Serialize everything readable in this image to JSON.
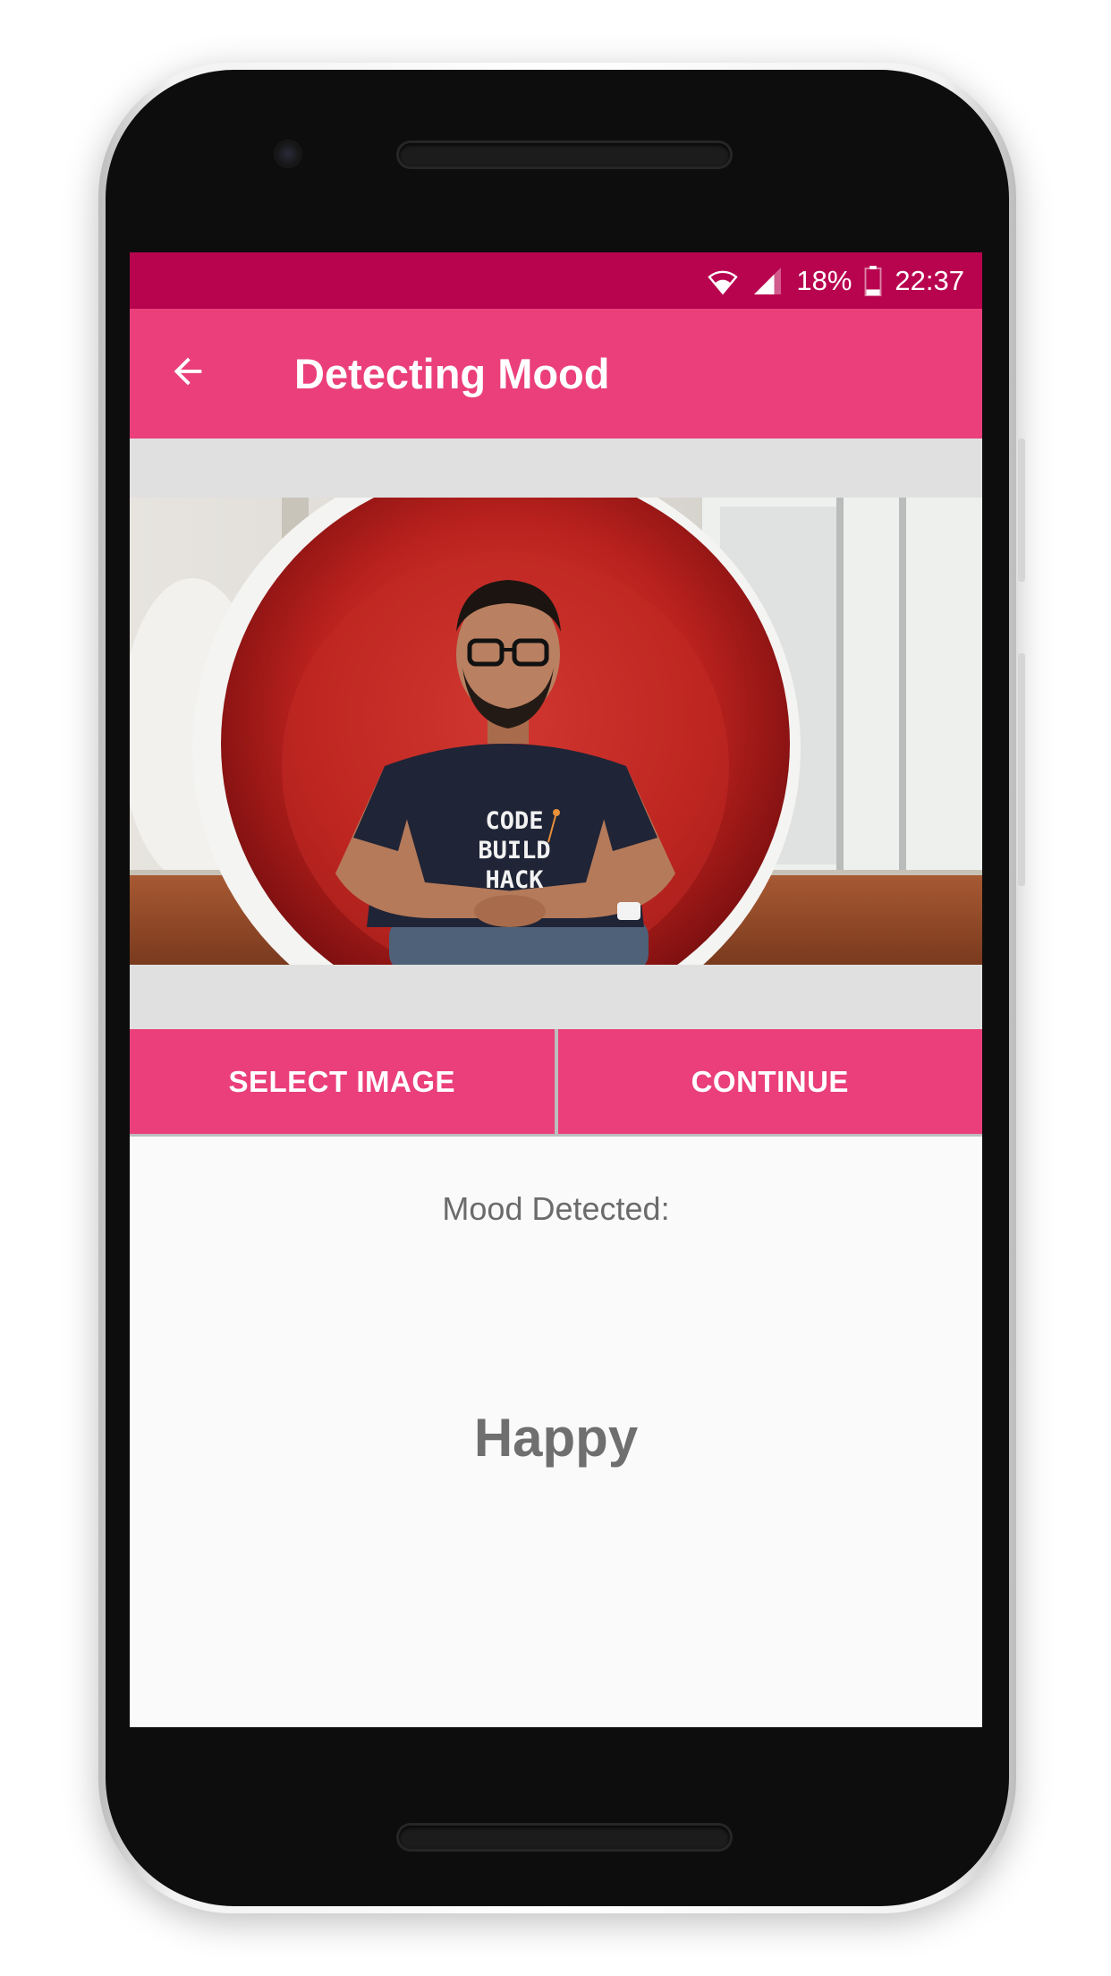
{
  "status_bar": {
    "battery": "18%",
    "time": "22:37",
    "icons": [
      "wifi-icon",
      "signal-icon",
      "battery-icon"
    ]
  },
  "toolbar": {
    "title": "Detecting Mood",
    "back_icon": "arrow-left-icon"
  },
  "photo": {
    "shirt_text_line1": "CODE",
    "shirt_text_line2": "BUILD",
    "shirt_text_line3": "HACK"
  },
  "actions": {
    "select_image": "SELECT IMAGE",
    "continue": "CONTINUE"
  },
  "result": {
    "label": "Mood Detected:",
    "value": "Happy"
  },
  "colors": {
    "status_bar": "#b8044f",
    "accent": "#ea3f7a",
    "background": "#fafafa",
    "text_gray": "#6b6b6b"
  }
}
